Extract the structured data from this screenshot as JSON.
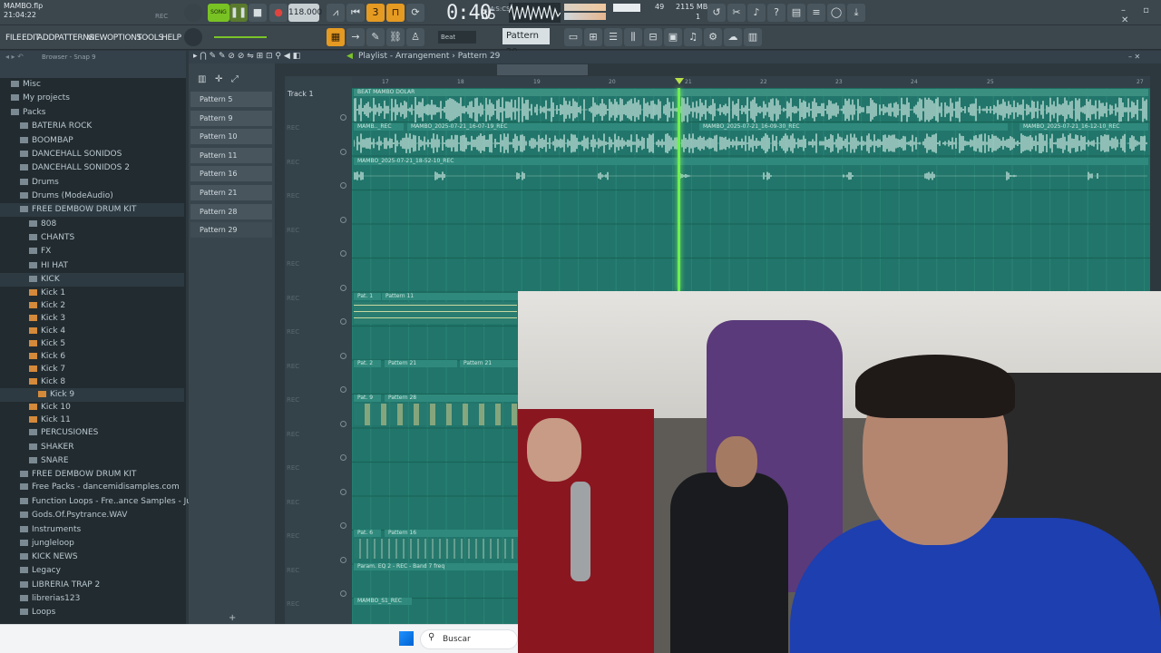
{
  "topbar": {
    "filename": "MAMBO.flp",
    "clock": "21:04:22",
    "rec_label": "REC",
    "song_label": "SONG",
    "tempo": "118.000",
    "time": "0:40",
    "time_frames": "55",
    "time_unit": "M:S:CS",
    "cpu": "49",
    "memory": "2115 MB",
    "poly": "1",
    "win_controls": "–  ▫  ✕"
  },
  "menu": {
    "items": [
      "FILE",
      "EDIT",
      "ADD",
      "PATTERNS",
      "VIEW",
      "OPTIONS",
      "TOOLS",
      "HELP"
    ],
    "snap": "Beat",
    "pattern": "Pattern 29"
  },
  "browser": {
    "title": "Browser - Snap 9",
    "items": [
      {
        "label": "Misc",
        "indent": 1
      },
      {
        "label": "My projects",
        "indent": 1
      },
      {
        "label": "Packs",
        "indent": 1
      },
      {
        "label": "BATERIA ROCK",
        "indent": 2
      },
      {
        "label": "BOOMBAP",
        "indent": 2
      },
      {
        "label": "DANCEHALL SONIDOS",
        "indent": 2
      },
      {
        "label": "DANCEHALL SONIDOS 2",
        "indent": 2
      },
      {
        "label": "Drums",
        "indent": 2
      },
      {
        "label": "Drums (ModeAudio)",
        "indent": 2
      },
      {
        "label": "FREE DEMBOW DRUM KIT",
        "indent": 2
      },
      {
        "label": "808",
        "indent": 3
      },
      {
        "label": "CHANTS",
        "indent": 3
      },
      {
        "label": "FX",
        "indent": 3
      },
      {
        "label": "HI HAT",
        "indent": 3
      },
      {
        "label": "KICK",
        "indent": 3
      },
      {
        "label": "Kick 1",
        "indent": 3
      },
      {
        "label": "Kick 2",
        "indent": 3
      },
      {
        "label": "Kick 3",
        "indent": 3
      },
      {
        "label": "Kick 4",
        "indent": 3
      },
      {
        "label": "Kick 5",
        "indent": 3
      },
      {
        "label": "Kick 6",
        "indent": 3
      },
      {
        "label": "Kick 7",
        "indent": 3
      },
      {
        "label": "Kick 8",
        "indent": 3
      },
      {
        "label": "Kick 9",
        "indent": 4
      },
      {
        "label": "Kick 10",
        "indent": 3
      },
      {
        "label": "Kick 11",
        "indent": 3
      },
      {
        "label": "PERCUSIONES",
        "indent": 3
      },
      {
        "label": "SHAKER",
        "indent": 3
      },
      {
        "label": "SNARE",
        "indent": 3
      },
      {
        "label": "FREE DEMBOW DRUM KIT",
        "indent": 2
      },
      {
        "label": "Free Packs - dancemidisamples.com",
        "indent": 2
      },
      {
        "label": "Function Loops - Fre..ance Samples - June 21",
        "indent": 2
      },
      {
        "label": "Gods.Of.Psytrance.WAV",
        "indent": 2
      },
      {
        "label": "Instruments",
        "indent": 2
      },
      {
        "label": "jungleloop",
        "indent": 2
      },
      {
        "label": "KICK NEWS",
        "indent": 2
      },
      {
        "label": "Legacy",
        "indent": 2
      },
      {
        "label": "LIBRERIA TRAP 2",
        "indent": 2
      },
      {
        "label": "librerias123",
        "indent": 2
      },
      {
        "label": "Loops",
        "indent": 2
      }
    ]
  },
  "patterns": [
    "Pattern 5",
    "Pattern 9",
    "Pattern 10",
    "Pattern 11",
    "Pattern 16",
    "Pattern 21",
    "Pattern 28",
    "Pattern 29"
  ],
  "playlist": {
    "title": "Playlist - Arrangement",
    "pattern": "Pattern 29",
    "track1": "Track 1",
    "rec": "REC",
    "ruler": [
      "17",
      "18",
      "19",
      "20",
      "21",
      "22",
      "23",
      "24",
      "25",
      "27"
    ],
    "clips": {
      "beat": "BEAT MAMBO DOLAR",
      "rec_a": "MAMB.._REC",
      "rec_b": "MAMBO_2025-07-21_16-07-19_REC",
      "rec_c": "MAMBO_2025-07-21_16-09-30_REC",
      "rec_d": "MAMBO_2025-07-21_16-12-10_REC",
      "rec_e": "MAMBO_2025-07-21_18-52-10_REC",
      "pat_a": "Pat. 1",
      "pat_b": "Pattern 11",
      "pat_c": "Pat. 2",
      "pat_d": "Pattern 21",
      "pat_e": "Pattern 21",
      "pat_f": "Pat. 9",
      "pat_g": "Pattern 28",
      "pat_h": "Pat. 6",
      "pat_i": "Pattern 16",
      "param": "Param. EQ 2 - REC - Band 7 freq",
      "mambo_s": "MAMBO_S1_REC"
    }
  },
  "taskbar": {
    "search": "Buscar"
  }
}
